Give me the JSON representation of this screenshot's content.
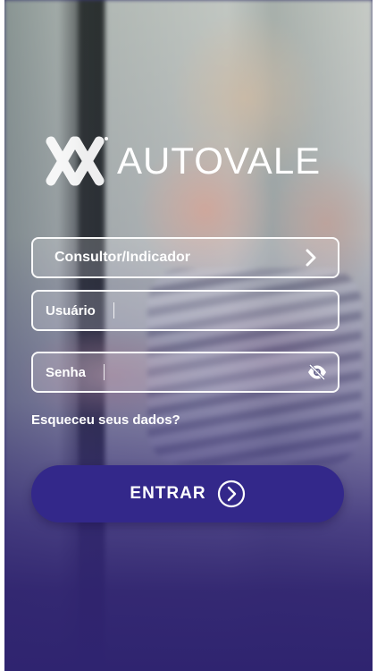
{
  "brand": {
    "name": "AUTOVALE",
    "logo_icon": "autovale-logo-icon"
  },
  "form": {
    "profile_select": {
      "label": "Consultor/Indicador",
      "icon": "chevron-right-icon"
    },
    "username": {
      "label": "Usuário",
      "value": ""
    },
    "password": {
      "label": "Senha",
      "value": "",
      "icon": "eye-off-icon"
    },
    "forgot_link": "Esqueceu seus dados?",
    "submit": {
      "label": "ENTRAR",
      "icon": "arrow-circle-right-icon"
    }
  },
  "colors": {
    "button_bg": "#33288a",
    "overlay_bottom": "#2f2470",
    "text": "#ffffff"
  }
}
